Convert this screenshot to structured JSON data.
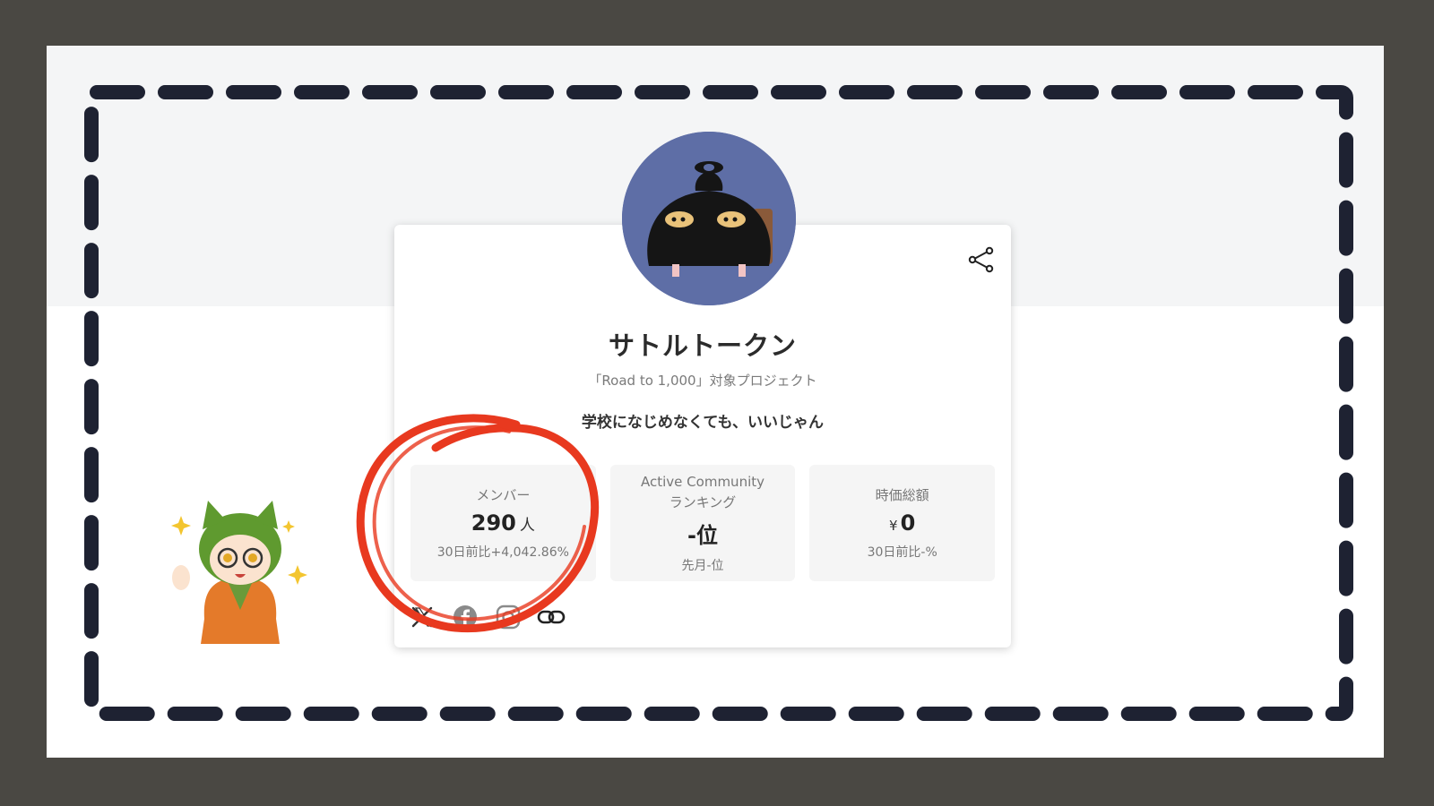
{
  "project": {
    "name": "サトルトークン",
    "subtitle": "「Road to 1,000」対象プロジェクト",
    "tagline": "学校になじめなくても、いいじゃん"
  },
  "stats": [
    {
      "label": "メンバー",
      "value": "290",
      "unit": "人",
      "sub": "30日前比+4,042.86%"
    },
    {
      "label_line1": "Active Community",
      "label_line2": "ランキング",
      "value": "-位",
      "sub": "先月-位"
    },
    {
      "label": "時価総額",
      "currency": "¥",
      "value": "0",
      "sub": "30日前比-%"
    }
  ],
  "icons": {
    "share": "share-icon",
    "socials": [
      "x-icon",
      "facebook-icon",
      "instagram-icon",
      "link-icon"
    ]
  },
  "colors": {
    "avatar_bg": "#5e6ea6",
    "annotation": "#e8391f",
    "frame_dash": "#1e2232",
    "outer_bg": "#4a4843"
  }
}
